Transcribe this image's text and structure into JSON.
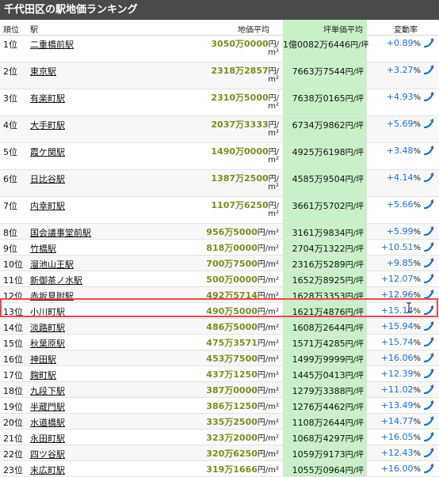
{
  "header": {
    "title": "千代田区の駅地価ランキング"
  },
  "columns": {
    "rank": "順位",
    "station": "駅",
    "price": "地価平均",
    "tsubo": "坪単価平均",
    "change": "変動率"
  },
  "units": {
    "price": "円/",
    "sq": "m²",
    "price_inline": "円/m²",
    "tsubo": "円/坪",
    "pct": "%"
  },
  "rows": [
    {
      "rank": "1位",
      "station": "二重橋前駅",
      "price": "3050万0000",
      "tsubo": "1億0082万6446",
      "change": "+0.89"
    },
    {
      "rank": "2位",
      "station": "東京駅",
      "price": "2318万2857",
      "tsubo": "7663万7544",
      "change": "+3.27"
    },
    {
      "rank": "3位",
      "station": "有楽町駅",
      "price": "2310万5000",
      "tsubo": "7638万0165",
      "change": "+4.93"
    },
    {
      "rank": "4位",
      "station": "大手町駅",
      "price": "2037万3333",
      "tsubo": "6734万9862",
      "change": "+5.69"
    },
    {
      "rank": "5位",
      "station": "霞ケ関駅",
      "price": "1490万0000",
      "tsubo": "4925万6198",
      "change": "+3.48"
    },
    {
      "rank": "6位",
      "station": "日比谷駅",
      "price": "1387万2500",
      "tsubo": "4585万9504",
      "change": "+4.14"
    },
    {
      "rank": "7位",
      "station": "内幸町駅",
      "price": "1107万6250",
      "tsubo": "3661万5702",
      "change": "+5.66"
    },
    {
      "rank": "8位",
      "station": "国会議事堂前駅",
      "price": "956万5000",
      "tsubo": "3161万9834",
      "change": "+5.99"
    },
    {
      "rank": "9位",
      "station": "竹橋駅",
      "price": "818万0000",
      "tsubo": "2704万1322",
      "change": "+10.51"
    },
    {
      "rank": "10位",
      "station": "溜池山王駅",
      "price": "700万7500",
      "tsubo": "2316万5289",
      "change": "+9.85"
    },
    {
      "rank": "11位",
      "station": "新御茶ノ水駅",
      "price": "500万0000",
      "tsubo": "1652万8925",
      "change": "+12.07"
    },
    {
      "rank": "12位",
      "station": "赤坂見附駅",
      "price": "492万5714",
      "tsubo": "1628万3353",
      "change": "+12.96"
    },
    {
      "rank": "13位",
      "station": "小川町駅",
      "price": "490万5000",
      "tsubo": "1621万4876",
      "change": "+15.14"
    },
    {
      "rank": "14位",
      "station": "淡路町駅",
      "price": "486万5000",
      "tsubo": "1608万2644",
      "change": "+15.94"
    },
    {
      "rank": "15位",
      "station": "秋葉原駅",
      "price": "475万3571",
      "tsubo": "1571万4285",
      "change": "+15.74"
    },
    {
      "rank": "16位",
      "station": "神田駅",
      "price": "453万7500",
      "tsubo": "1499万9999",
      "change": "+16.06"
    },
    {
      "rank": "17位",
      "station": "麹町駅",
      "price": "437万1250",
      "tsubo": "1445万0413",
      "change": "+12.39"
    },
    {
      "rank": "18位",
      "station": "九段下駅",
      "price": "387万0000",
      "tsubo": "1279万3388",
      "change": "+11.02"
    },
    {
      "rank": "19位",
      "station": "半蔵門駅",
      "price": "386万1250",
      "tsubo": "1276万4462",
      "change": "+13.49"
    },
    {
      "rank": "20位",
      "station": "水道橋駅",
      "price": "335万2500",
      "tsubo": "1108万2644",
      "change": "+14.77"
    },
    {
      "rank": "21位",
      "station": "永田町駅",
      "price": "323万2000",
      "tsubo": "1068万4297",
      "change": "+16.05"
    },
    {
      "rank": "22位",
      "station": "四ツ谷駅",
      "price": "320万6250",
      "tsubo": "1059万9173",
      "change": "+12.43"
    },
    {
      "rank": "23位",
      "station": "末広町駅",
      "price": "319万1666",
      "tsubo": "1055万0964",
      "change": "+16.00"
    }
  ],
  "highlighted_rank": "16位",
  "colors": {
    "header_bg": "#4a4a4a",
    "price_text": "#7a8c1e",
    "tsubo_bg": "#c9f0c9",
    "change_text": "#1a6fd8",
    "highlight_border": "#e84a4a"
  },
  "icons": {
    "trend": "trend-up-icon",
    "cursor": "text-cursor-icon"
  }
}
